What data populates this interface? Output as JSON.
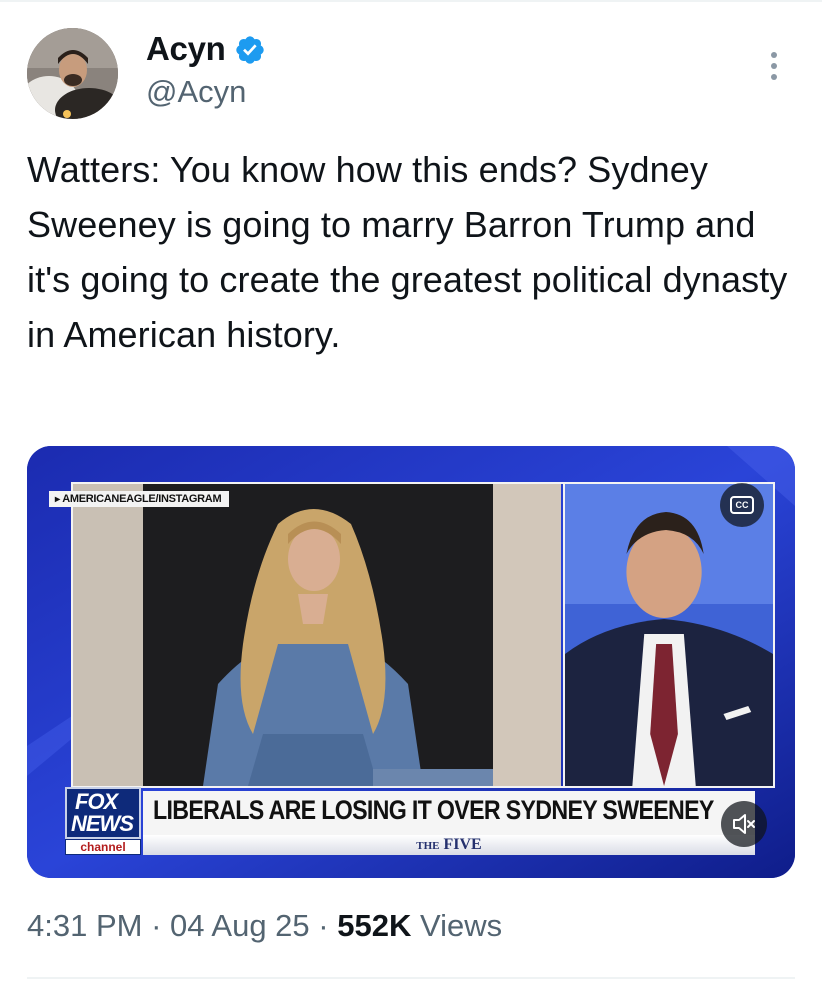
{
  "author": {
    "display_name": "Acyn",
    "handle": "@Acyn",
    "verified": true,
    "verified_icon": "verified-badge-icon",
    "avatar_icon": "profile-avatar"
  },
  "tweet": {
    "text": "Watters: You know how this ends? Sydney Sweeney is going to marry Barron Trump and it's going to create the greatest political dynasty in American history."
  },
  "media": {
    "credit": "AMERICANEAGLE/INSTAGRAM",
    "cc_label": "CC",
    "headline": "LIBERALS ARE LOSING IT OVER SYDNEY SWEENEY",
    "show_prefix": "THE",
    "show_name": "FIVE",
    "logo_line1": "FOX",
    "logo_line2": "NEWS",
    "logo_line3": "channel",
    "mute_icon": "speaker-muted-icon"
  },
  "meta": {
    "time": "4:31 PM",
    "separator": "·",
    "date": "04 Aug 25",
    "views_count": "552K",
    "views_label": "Views"
  },
  "colors": {
    "text_primary": "#0f1419",
    "text_secondary": "#536471",
    "verified_blue": "#1d9bf0",
    "fox_blue": "#1c2fb3"
  }
}
